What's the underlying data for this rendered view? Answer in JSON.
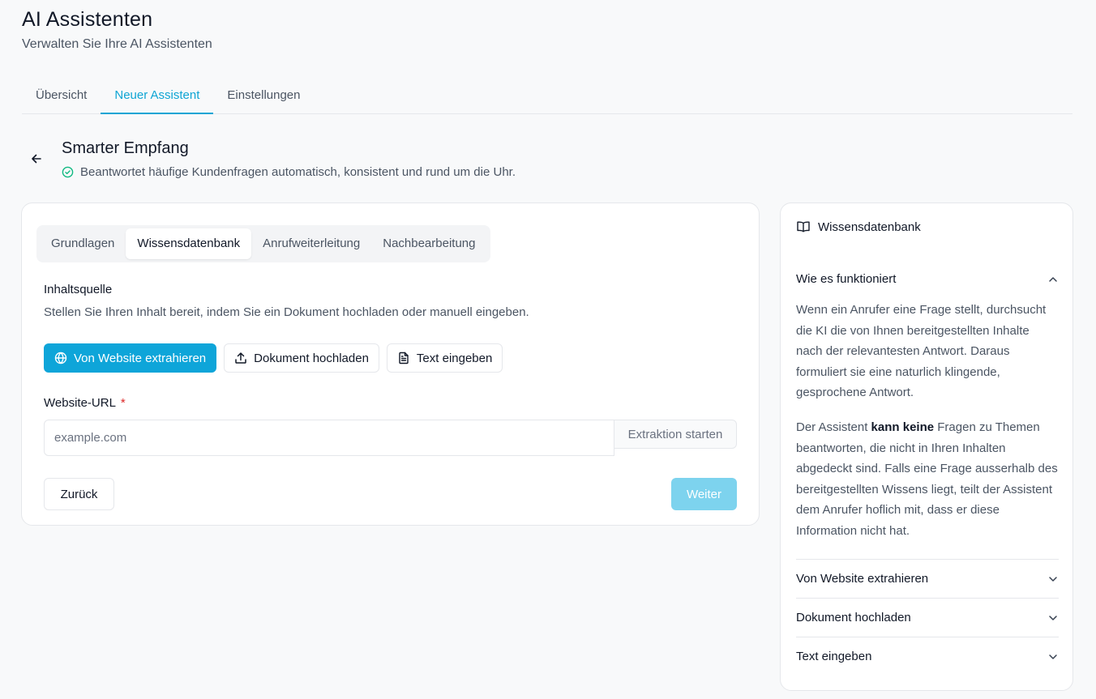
{
  "header": {
    "title": "AI Assistenten",
    "subtitle": "Verwalten Sie Ihre AI Assistenten"
  },
  "tabs": [
    {
      "label": "Übersicht",
      "active": false
    },
    {
      "label": "Neuer Assistent",
      "active": true
    },
    {
      "label": "Einstellungen",
      "active": false
    }
  ],
  "assistant": {
    "title": "Smarter Empfang",
    "description": "Beantwortet häufige Kundenfragen automatisch, konsistent und rund um die Uhr."
  },
  "subtabs": [
    {
      "label": "Grundlagen",
      "active": false
    },
    {
      "label": "Wissensdatenbank",
      "active": true
    },
    {
      "label": "Anrufweiterleitung",
      "active": false
    },
    {
      "label": "Nachbearbeitung",
      "active": false
    }
  ],
  "content_source": {
    "label": "Inhaltsquelle",
    "description": "Stellen Sie Ihren Inhalt bereit, indem Sie ein Dokument hochladen oder manuell eingeben.",
    "buttons": {
      "website": "Von Website extrahieren",
      "upload": "Dokument hochladen",
      "text": "Text eingeben"
    }
  },
  "url_field": {
    "label": "Website-URL",
    "required_marker": "*",
    "placeholder": "example.com",
    "value": "",
    "action": "Extraktion starten"
  },
  "actions": {
    "back": "Zurück",
    "next": "Weiter"
  },
  "sidebar": {
    "title": "Wissensdatenbank",
    "open_section": {
      "title": "Wie es funktioniert",
      "para1": "Wenn ein Anrufer eine Frage stellt, durchsucht die KI die von Ihnen bereitgestellten Inhalte nach der relevantesten Antwort. Daraus formuliert sie eine naturlich klingende, gesprochene Antwort.",
      "para2_start": "Der Assistent ",
      "para2_bold": "kann keine",
      "para2_end": " Fragen zu Themen beantworten, die nicht in Ihren Inhalten abgedeckt sind. Falls eine Frage ausserhalb des bereitgestellten Wissens liegt, teilt der Assistent dem Anrufer hoflich mit, dass er diese Information nicht hat."
    },
    "sections": [
      {
        "title": "Von Website extrahieren"
      },
      {
        "title": "Dokument hochladen"
      },
      {
        "title": "Text eingeben"
      }
    ]
  },
  "colors": {
    "accent": "#0ea5d9",
    "accent_disabled": "#7dd3ee",
    "success": "#10b981",
    "required": "#dc2626"
  }
}
